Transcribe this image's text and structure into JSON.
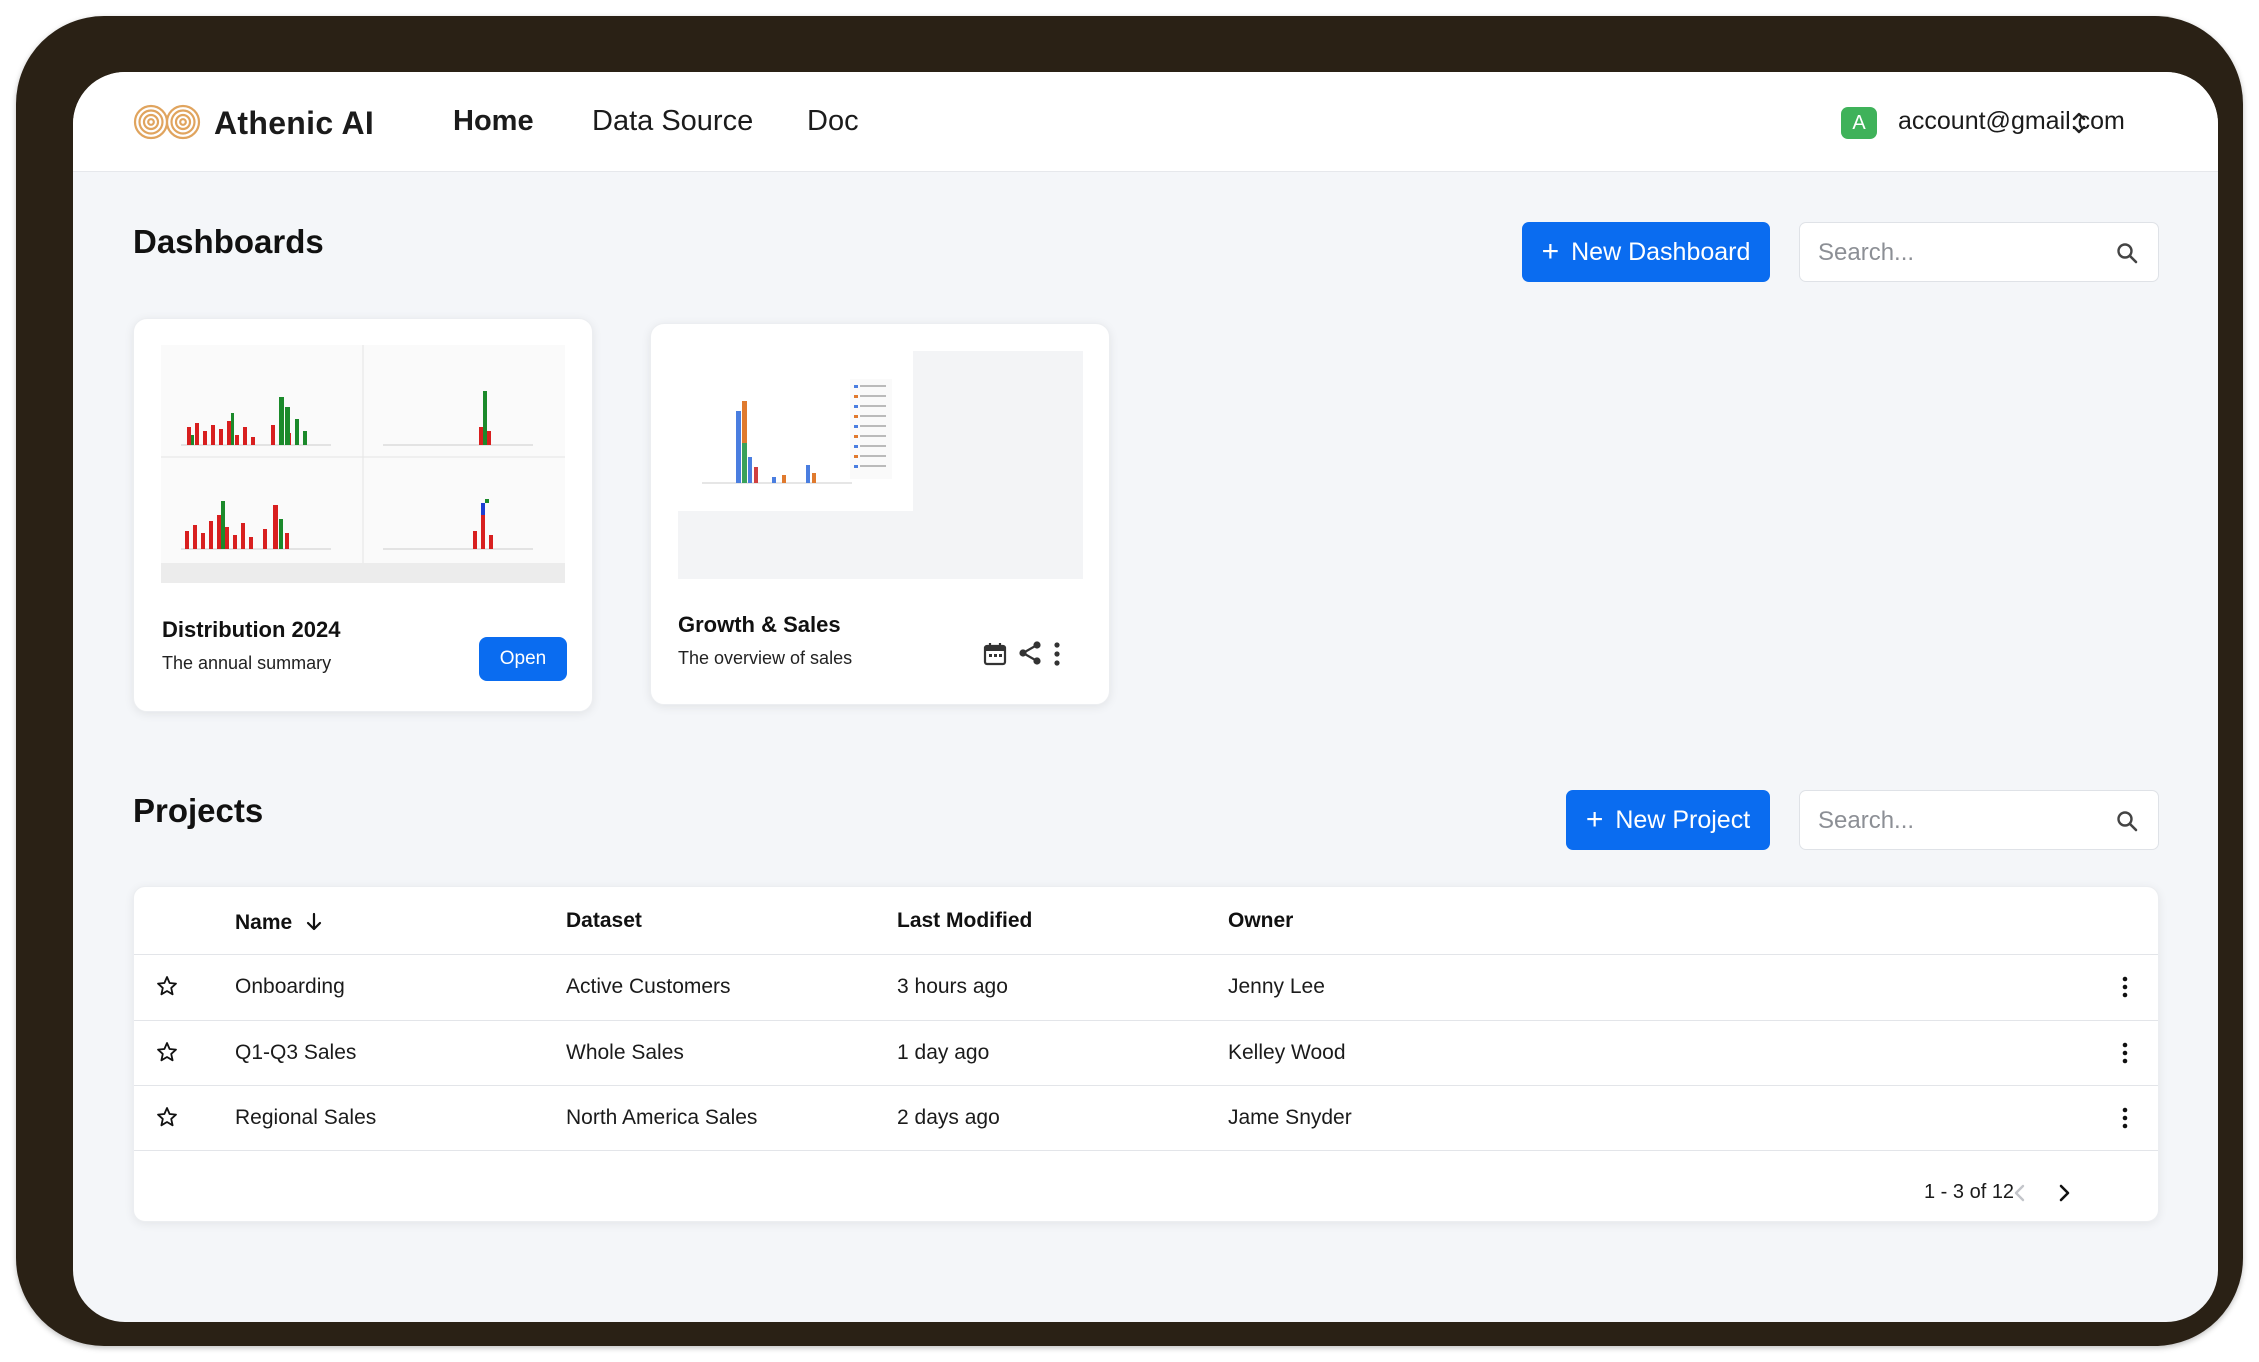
{
  "app": {
    "brand": "Athenic AI",
    "nav": [
      {
        "label": "Home",
        "active": true
      },
      {
        "label": "Data Source",
        "active": false
      },
      {
        "label": "Doc",
        "active": false
      }
    ],
    "account": {
      "avatar_letter": "A",
      "email": "account@gmail.com",
      "avatar_color": "#3fb25a"
    }
  },
  "dashboards": {
    "title": "Dashboards",
    "new_button": "New Dashboard",
    "search_placeholder": "Search...",
    "cards": [
      {
        "title": "Distribution 2024",
        "subtitle": "The annual summary",
        "action": "Open"
      },
      {
        "title": "Growth & Sales",
        "subtitle": "The overview of sales",
        "icons": [
          "calendar-icon",
          "share-icon",
          "more-vert-icon"
        ]
      }
    ]
  },
  "projects": {
    "title": "Projects",
    "new_button": "New Project",
    "search_placeholder": "Search...",
    "columns": [
      "Name",
      "Dataset",
      "Last Modified",
      "Owner"
    ],
    "sort_column": "Name",
    "rows": [
      {
        "name": "Onboarding",
        "dataset": "Active Customers",
        "modified": "3 hours ago",
        "owner": "Jenny Lee"
      },
      {
        "name": "Q1-Q3 Sales",
        "dataset": "Whole Sales",
        "modified": "1 day ago",
        "owner": "Kelley Wood"
      },
      {
        "name": "Regional Sales",
        "dataset": "North America Sales",
        "modified": "2 days ago",
        "owner": "Jame Snyder"
      }
    ],
    "pagination": "1 - 3 of 12"
  },
  "theme": {
    "accent": "#0a6cf0",
    "frame": "#2a2115",
    "background": "#f4f6f9"
  }
}
